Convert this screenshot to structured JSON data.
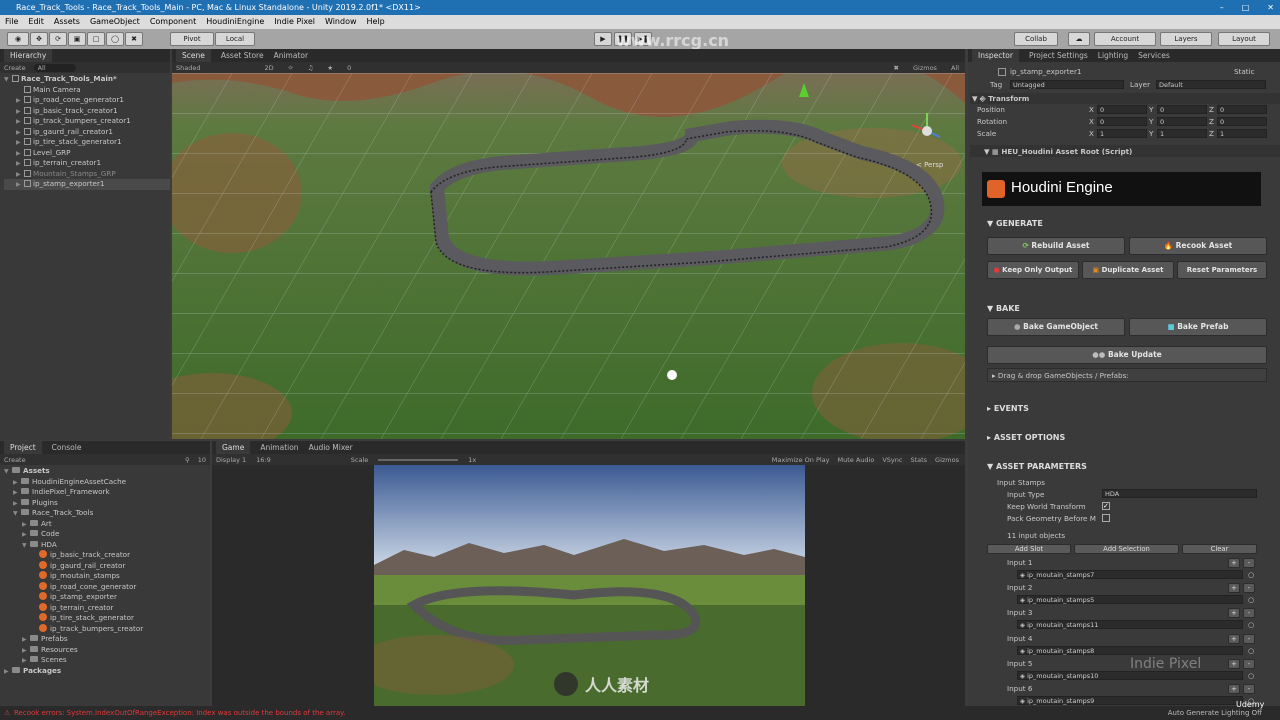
{
  "window": {
    "title": "Race_Track_Tools - Race_Track_Tools_Main - PC, Mac & Linux Standalone - Unity 2019.2.0f1* <DX11>"
  },
  "menu": [
    "File",
    "Edit",
    "Assets",
    "GameObject",
    "Component",
    "HoudiniEngine",
    "Indie Pixel",
    "Window",
    "Help"
  ],
  "toolbar": {
    "pivot": "Pivot",
    "local": "Local",
    "collab": "Collab",
    "account": "Account",
    "layers": "Layers",
    "layout": "Layout",
    "watermark": "www.rrcg.cn"
  },
  "hierarchy": {
    "tab": "Hierarchy",
    "create": "Create",
    "search": "All",
    "root": "Race_Track_Tools_Main*",
    "items": [
      {
        "label": "Main Camera",
        "dim": false
      },
      {
        "label": "ip_road_cone_generator1",
        "dim": false
      },
      {
        "label": "ip_basic_track_creator1",
        "dim": false
      },
      {
        "label": "ip_track_bumpers_creator1",
        "dim": false
      },
      {
        "label": "ip_gaurd_rail_creator1",
        "dim": false
      },
      {
        "label": "ip_tire_stack_generator1",
        "dim": false
      },
      {
        "label": "Level_GRP",
        "dim": false
      },
      {
        "label": "ip_terrain_creator1",
        "dim": false
      },
      {
        "label": "Mountain_Stamps_GRP",
        "dim": true
      },
      {
        "label": "ip_stamp_exporter1",
        "dim": false
      }
    ]
  },
  "scene": {
    "tabs": [
      "Scene",
      "Asset Store",
      "Animator"
    ],
    "shading": "Shaded",
    "mode2d": "2D",
    "gizmos": "Gizmos",
    "search": "All",
    "persp": "< Persp",
    "layers_count": "0"
  },
  "project": {
    "tabs": [
      "Project",
      "Console"
    ],
    "create": "Create",
    "count": "10",
    "tree": [
      {
        "label": "Assets",
        "depth": 0,
        "type": "folder",
        "bold": true
      },
      {
        "label": "HoudiniEngineAssetCache",
        "depth": 1,
        "type": "folder"
      },
      {
        "label": "IndiePixel_Framework",
        "depth": 1,
        "type": "folder"
      },
      {
        "label": "Plugins",
        "depth": 1,
        "type": "folder"
      },
      {
        "label": "Race_Track_Tools",
        "depth": 1,
        "type": "folder"
      },
      {
        "label": "Art",
        "depth": 2,
        "type": "folder"
      },
      {
        "label": "Code",
        "depth": 2,
        "type": "folder"
      },
      {
        "label": "HDA",
        "depth": 2,
        "type": "folder"
      },
      {
        "label": "ip_basic_track_creator",
        "depth": 3,
        "type": "hda"
      },
      {
        "label": "ip_gaurd_rail_creator",
        "depth": 3,
        "type": "hda"
      },
      {
        "label": "ip_moutain_stamps",
        "depth": 3,
        "type": "hda"
      },
      {
        "label": "ip_road_cone_generator",
        "depth": 3,
        "type": "hda"
      },
      {
        "label": "ip_stamp_exporter",
        "depth": 3,
        "type": "hda"
      },
      {
        "label": "ip_terrain_creator",
        "depth": 3,
        "type": "hda"
      },
      {
        "label": "ip_tire_stack_generator",
        "depth": 3,
        "type": "hda"
      },
      {
        "label": "ip_track_bumpers_creator",
        "depth": 3,
        "type": "hda"
      },
      {
        "label": "Prefabs",
        "depth": 2,
        "type": "folder"
      },
      {
        "label": "Resources",
        "depth": 2,
        "type": "folder"
      },
      {
        "label": "Scenes",
        "depth": 2,
        "type": "folder"
      },
      {
        "label": "Packages",
        "depth": 0,
        "type": "folder",
        "bold": true
      }
    ]
  },
  "game": {
    "tabs": [
      "Game",
      "Animation",
      "Audio Mixer"
    ],
    "display": "Display 1",
    "aspect": "16:9",
    "scale_label": "Scale",
    "scale_value": "1x",
    "options": [
      "Maximize On Play",
      "Mute Audio",
      "VSync",
      "Stats",
      "Gizmos"
    ],
    "logo_text": "人人素材"
  },
  "status": {
    "error": "Recook errors: System.IndexOutOfRangeException: Index was outside the bounds of the array.",
    "right": "Auto Generate Lighting Off"
  },
  "inspector": {
    "tabs": [
      "Inspector",
      "Project Settings",
      "Lighting",
      "Services"
    ],
    "object_name": "ip_stamp_exporter1",
    "static": "Static",
    "tag_label": "Tag",
    "tag_value": "Untagged",
    "layer_label": "Layer",
    "layer_value": "Default",
    "transform_title": "Transform",
    "transform": [
      {
        "label": "Position",
        "x": "0",
        "y": "0",
        "z": "0"
      },
      {
        "label": "Rotation",
        "x": "0",
        "y": "0",
        "z": "0"
      },
      {
        "label": "Scale",
        "x": "1",
        "y": "1",
        "z": "1"
      }
    ],
    "script_title": "HEU_Houdini Asset Root (Script)",
    "banner": "Houdini Engine",
    "generate": "GENERATE",
    "rebuild": "Rebuild Asset",
    "recook": "Recook Asset",
    "keep_only": "Keep Only Output",
    "duplicate": "Duplicate Asset",
    "reset_params": "Reset Parameters",
    "bake": "BAKE",
    "bake_go": "Bake GameObject",
    "bake_prefab": "Bake Prefab",
    "bake_update": "Bake Update",
    "drag_drop": "Drag & drop GameObjects / Prefabs:",
    "events": "EVENTS",
    "asset_options": "ASSET OPTIONS",
    "asset_params": "ASSET PARAMETERS",
    "input_stamps": "Input Stamps",
    "input_type_label": "Input Type",
    "input_type_value": "HDA",
    "keep_world": "Keep World Transform",
    "pack_geo": "Pack Geometry Before M",
    "input_count": "11 input objects",
    "add_slot": "Add Slot",
    "add_selection": "Add Selection",
    "clear": "Clear",
    "inputs": [
      {
        "label": "Input 1",
        "value": "ip_moutain_stamps7"
      },
      {
        "label": "Input 2",
        "value": "ip_moutain_stamps5"
      },
      {
        "label": "Input 3",
        "value": "ip_moutain_stamps11"
      },
      {
        "label": "Input 4",
        "value": "ip_moutain_stamps8"
      },
      {
        "label": "Input 5",
        "value": "ip_moutain_stamps10"
      },
      {
        "label": "Input 6",
        "value": "ip_moutain_stamps9"
      }
    ],
    "udemy": "Udemy",
    "indie_pixel": "Indie Pixel"
  },
  "colors": {
    "titlebar": "#1f6fb3",
    "panel": "#393939",
    "error": "#e03a3a"
  }
}
